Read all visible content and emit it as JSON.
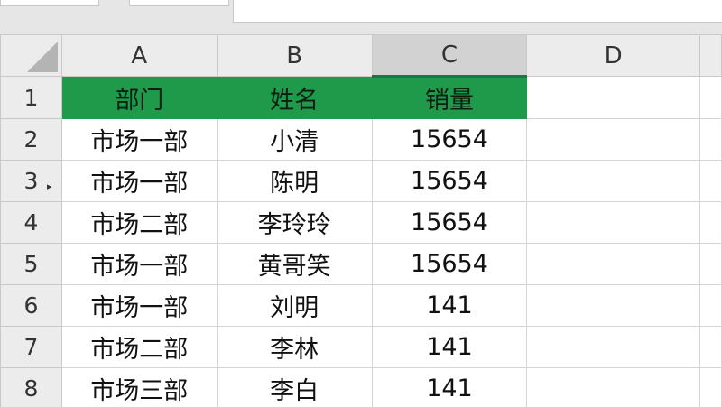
{
  "columns": [
    "A",
    "B",
    "C",
    "D"
  ],
  "rows": [
    {
      "num": "1",
      "cells": [
        "部门",
        "姓名",
        "销量",
        ""
      ]
    },
    {
      "num": "2",
      "cells": [
        "市场一部",
        "小清",
        "15654",
        ""
      ]
    },
    {
      "num": "3",
      "cells": [
        "市场一部",
        "陈明",
        "15654",
        ""
      ]
    },
    {
      "num": "4",
      "cells": [
        "市场二部",
        "李玲玲",
        "15654",
        ""
      ]
    },
    {
      "num": "5",
      "cells": [
        "市场一部",
        "黄哥笑",
        "15654",
        ""
      ]
    },
    {
      "num": "6",
      "cells": [
        "市场一部",
        "刘明",
        "141",
        ""
      ]
    },
    {
      "num": "7",
      "cells": [
        "市场二部",
        "李林",
        "141",
        ""
      ]
    },
    {
      "num": "8",
      "cells": [
        "市场三部",
        "李白",
        "141",
        ""
      ]
    }
  ],
  "colors": {
    "header_fill": "#1e9a4a",
    "selected_column_accent": "#217346"
  },
  "selected_column": "C"
}
